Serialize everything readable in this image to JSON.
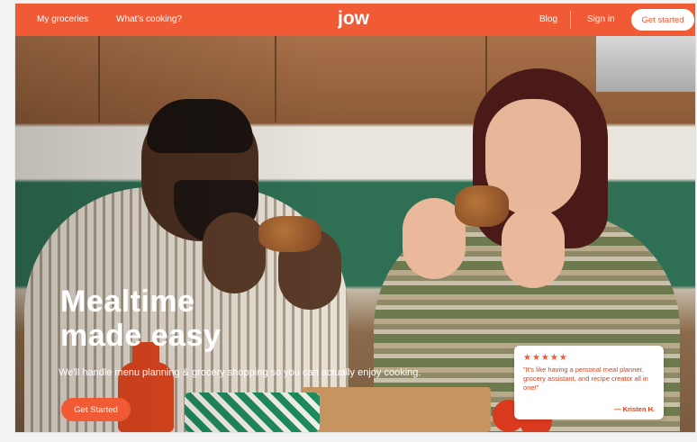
{
  "nav": {
    "links_left": [
      "My groceries",
      "What's cooking?"
    ],
    "logo_text": "jow",
    "links_right": [
      "Blog",
      "Sign in"
    ],
    "cta_label": "Get started"
  },
  "hero": {
    "headline": "Mealtime\nmade easy",
    "subline": "We'll handle menu planning & grocery shopping so you can actually enjoy cooking.",
    "cta_label": "Get Started"
  },
  "review": {
    "stars": "★★★★★",
    "quote": "\"It's like having a personal meal planner, grocery assistant, and recipe creator all in one!\"",
    "author": "— Kristen H."
  },
  "colors": {
    "brand": "#f05a35",
    "white": "#ffffff"
  },
  "icons": [
    "star-icon"
  ]
}
